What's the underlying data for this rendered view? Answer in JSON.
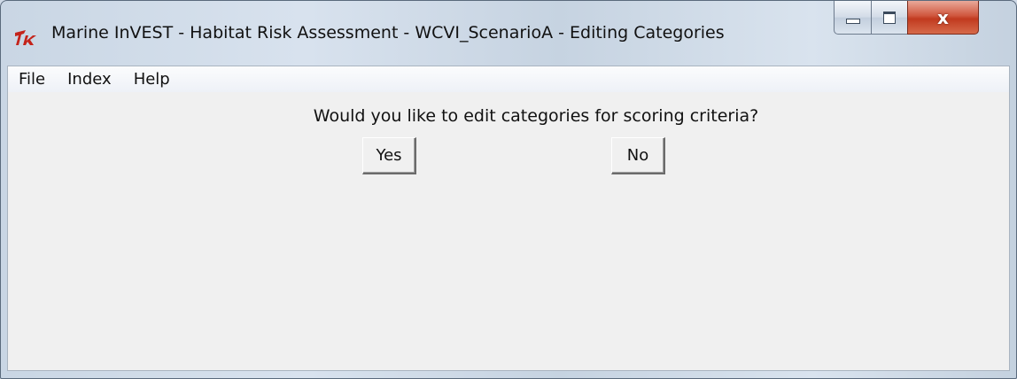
{
  "window": {
    "title": "Marine InVEST - Habitat Risk Assessment - WCVI_ScenarioA - Editing Categories",
    "app_icon": "tk-feather-icon",
    "controls": {
      "minimize": "minimize-icon",
      "maximize": "maximize-icon",
      "close_label": "x"
    }
  },
  "menubar": {
    "items": [
      {
        "label": "File"
      },
      {
        "label": "Index"
      },
      {
        "label": "Help"
      }
    ]
  },
  "dialog": {
    "question": "Would you like to edit categories for scoring criteria?",
    "yes_label": "Yes",
    "no_label": "No"
  },
  "colors": {
    "tk_logo": "#c4231a",
    "close_button": "#c8442a",
    "client_bg": "#f0f0f0"
  }
}
